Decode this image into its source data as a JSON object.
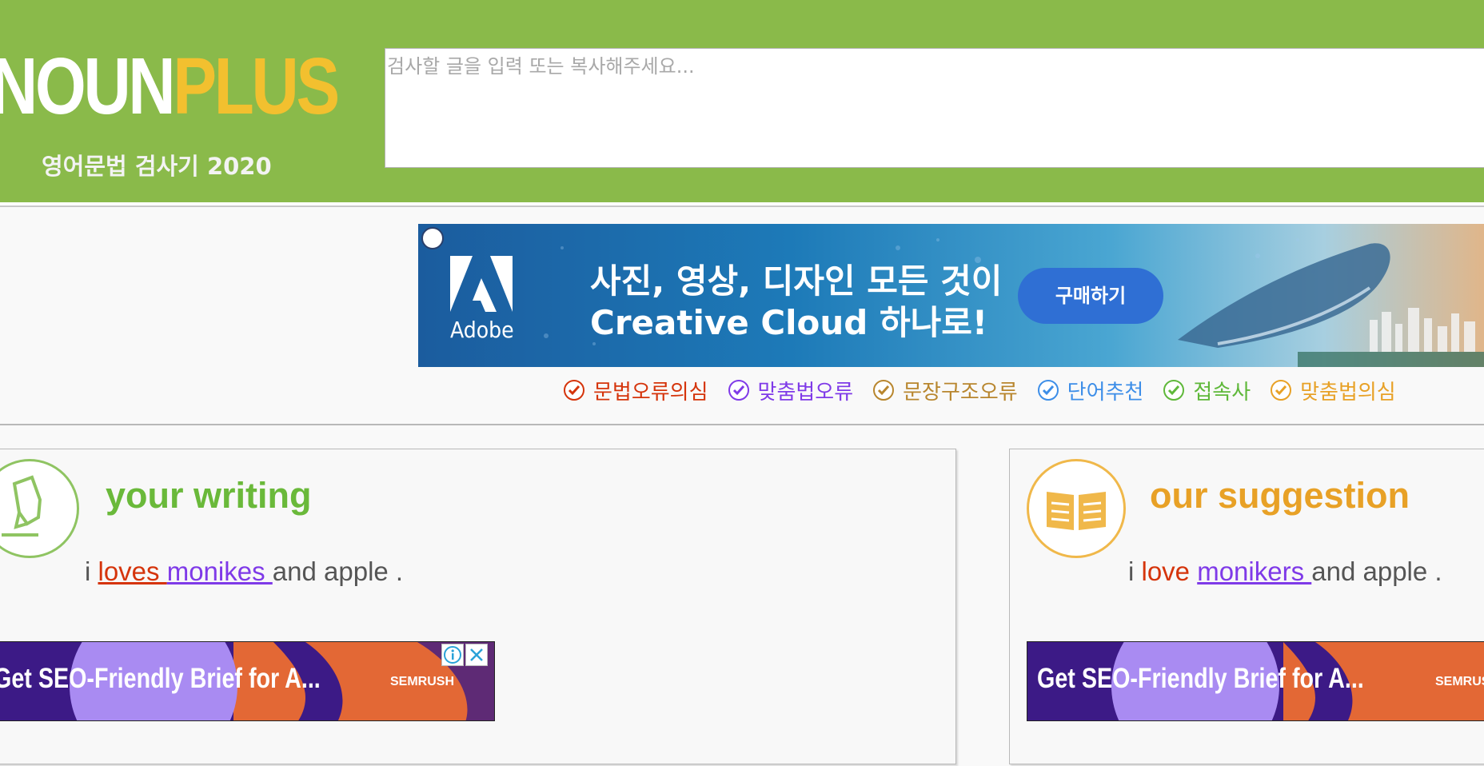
{
  "header": {
    "logo_part1": "NOUN",
    "logo_part2": "PLUS",
    "tagline": "영어문법 검사기 2020",
    "input_placeholder": "검사할 글을 입력 또는 복사해주세요..."
  },
  "ad_banner": {
    "brand": "Adobe",
    "line1": "사진, 영상, 디자인 모든 것이",
    "line2": "Creative Cloud 하나로!",
    "cta": "구매하기"
  },
  "legend": [
    {
      "label": "문법오류의심",
      "color": "#d5340b",
      "icon": "check-circle-icon"
    },
    {
      "label": "맞춤법오류",
      "color": "#7f3ae8",
      "icon": "check-circle-icon"
    },
    {
      "label": "문장구조오류",
      "color": "#b8862e",
      "icon": "check-circle-icon"
    },
    {
      "label": "단어추천",
      "color": "#3d8ee8",
      "icon": "check-circle-icon"
    },
    {
      "label": "접속사",
      "color": "#5fb83a",
      "icon": "check-circle-icon"
    },
    {
      "label": "맞춤법의심",
      "color": "#e8a126",
      "icon": "check-circle-icon"
    }
  ],
  "writing_panel": {
    "title": "your writing",
    "title_color": "#6ab93a",
    "icon": "highlighter-icon",
    "sentence": {
      "w1": "i ",
      "w2": "loves ",
      "w3": "monikes ",
      "w4": "and apple ."
    }
  },
  "suggestion_panel": {
    "title": "our suggestion",
    "title_color": "#e8a126",
    "icon": "book-icon",
    "sentence": {
      "w1": "i ",
      "w2": "love ",
      "w3": "monikers ",
      "w4": "and apple ."
    }
  },
  "semrush_ad": {
    "text": "Get SEO-Friendly Brief for A...",
    "brand": "SEMRUSH"
  },
  "colors": {
    "header_green": "#8aba4a",
    "logo_yellow": "#f2c02f"
  }
}
